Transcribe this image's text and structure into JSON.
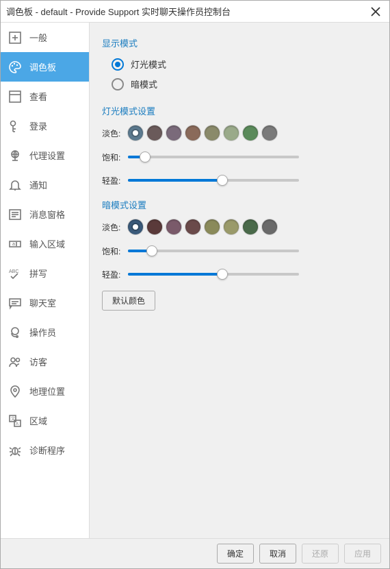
{
  "titlebar": {
    "title": "调色板 - default - Provide Support 实时聊天操作员控制台"
  },
  "sidebar": {
    "items": [
      {
        "label": "一般"
      },
      {
        "label": "调色板"
      },
      {
        "label": "查看"
      },
      {
        "label": "登录"
      },
      {
        "label": "代理设置"
      },
      {
        "label": "通知"
      },
      {
        "label": "消息窗格"
      },
      {
        "label": "输入区域"
      },
      {
        "label": "拼写"
      },
      {
        "label": "聊天室"
      },
      {
        "label": "操作员"
      },
      {
        "label": "访客"
      },
      {
        "label": "地理位置"
      },
      {
        "label": "区域"
      },
      {
        "label": "诊断程序"
      }
    ],
    "selected_index": 1
  },
  "main": {
    "display_mode_title": "显示模式",
    "radio_light": "灯光模式",
    "radio_dark": "暗模式",
    "light_settings_title": "灯光模式设置",
    "dark_settings_title": "暗模式设置",
    "tint_label": "淡色:",
    "saturation_label": "饱和:",
    "brightness_label": "轻盈:",
    "default_colors_btn": "默认颜色",
    "light_swatches": [
      "#5c7a8f",
      "#6a5a5a",
      "#7a6a7a",
      "#8a6a5a",
      "#8a8a6a",
      "#9aaa8a",
      "#5a8a5a",
      "#7a7a7a"
    ],
    "dark_swatches": [
      "#3a5a7a",
      "#5a3a3a",
      "#7a5a6a",
      "#6a4a4a",
      "#8a8a5a",
      "#9a9a6a",
      "#4a6a4a",
      "#6a6a6a"
    ],
    "light_sat_pct": 10,
    "light_bri_pct": 55,
    "dark_sat_pct": 14,
    "dark_bri_pct": 55
  },
  "footer": {
    "ok": "确定",
    "cancel": "取消",
    "restore": "还原",
    "apply": "应用"
  }
}
